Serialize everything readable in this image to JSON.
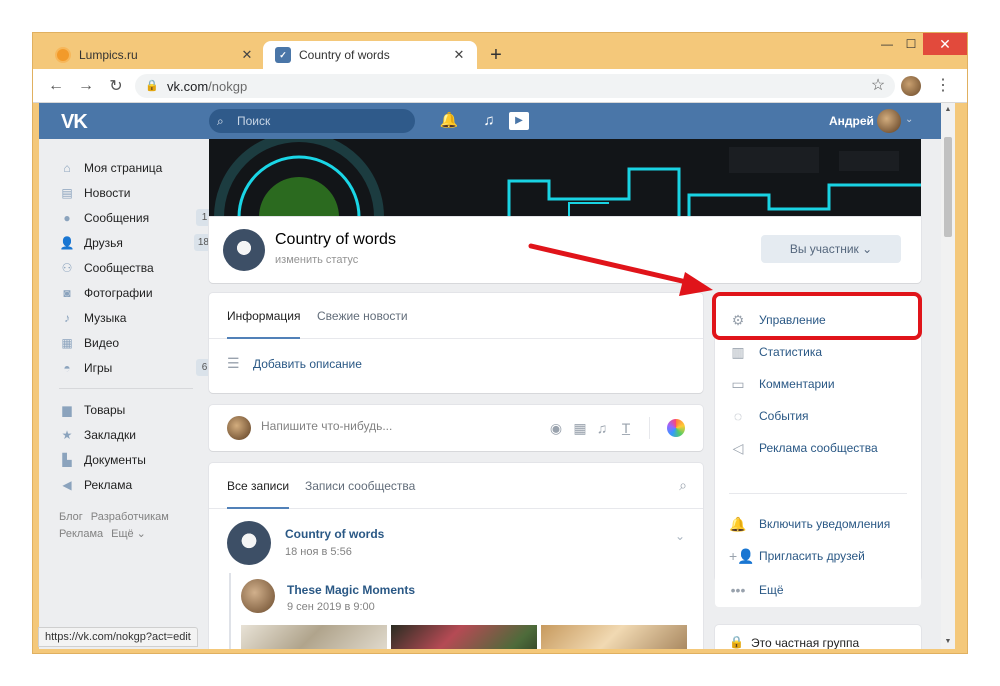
{
  "browser": {
    "tabs": [
      {
        "label": "Lumpics.ru",
        "close": "✕"
      },
      {
        "label": "Country of words",
        "close": "✕"
      }
    ],
    "new_tab": "+",
    "window_controls": {
      "minimize": "—",
      "maximize": "☐",
      "close": "✕"
    },
    "url_host": "vk.com",
    "url_path": "/nokgp",
    "status_url": "https://vk.com/nokgp?act=edit"
  },
  "vk": {
    "logo": "VK",
    "search_placeholder": "Поиск",
    "user_name": "Андрей"
  },
  "left_menu": {
    "items": [
      {
        "label": "Моя страница",
        "icon": "home-icon"
      },
      {
        "label": "Новости",
        "icon": "news-icon"
      },
      {
        "label": "Сообщения",
        "icon": "messages-icon",
        "badge": "1"
      },
      {
        "label": "Друзья",
        "icon": "friends-icon",
        "badge": "18"
      },
      {
        "label": "Сообщества",
        "icon": "communities-icon"
      },
      {
        "label": "Фотографии",
        "icon": "photos-icon"
      },
      {
        "label": "Музыка",
        "icon": "music-icon"
      },
      {
        "label": "Видео",
        "icon": "video-icon"
      },
      {
        "label": "Игры",
        "icon": "games-icon",
        "badge": "6"
      }
    ],
    "items2": [
      {
        "label": "Товары",
        "icon": "goods-icon"
      },
      {
        "label": "Закладки",
        "icon": "bookmarks-icon"
      },
      {
        "label": "Документы",
        "icon": "documents-icon"
      },
      {
        "label": "Реклама",
        "icon": "ads-icon"
      }
    ],
    "footer": [
      "Блог",
      "Разработчикам",
      "Реклама",
      "Ещё ⌄"
    ]
  },
  "group": {
    "name": "Country of words",
    "status": "изменить статус",
    "member_button": "Вы участник ⌄"
  },
  "info_tabs": {
    "tab1": "Информация",
    "tab2": "Свежие новости",
    "add_description": "Добавить описание"
  },
  "post_box": {
    "placeholder": "Напишите что-нибудь..."
  },
  "posts": {
    "tab1": "Все записи",
    "tab2": "Записи сообщества",
    "author": "Country of words",
    "date": "18 ноя в 5:56",
    "repost_author": "These Magic Moments",
    "repost_date": "9 сен 2019 в 9:00"
  },
  "right_menu": {
    "items": [
      {
        "label": "Управление",
        "icon": "gear-icon"
      },
      {
        "label": "Статистика",
        "icon": "stats-icon"
      },
      {
        "label": "Комментарии",
        "icon": "comments-icon"
      },
      {
        "label": "События",
        "icon": "events-icon"
      },
      {
        "label": "Реклама сообщества",
        "icon": "megaphone-icon"
      },
      {
        "label": "Включить уведомления",
        "icon": "bell-icon"
      },
      {
        "label": "Пригласить друзей",
        "icon": "invite-icon"
      },
      {
        "label": "Ещё",
        "icon": "more-icon"
      }
    ],
    "private_group": "Это частная группа"
  },
  "colors": {
    "vk_blue": "#4a76a8",
    "link": "#2a5885",
    "highlight_red": "#e0141a"
  }
}
